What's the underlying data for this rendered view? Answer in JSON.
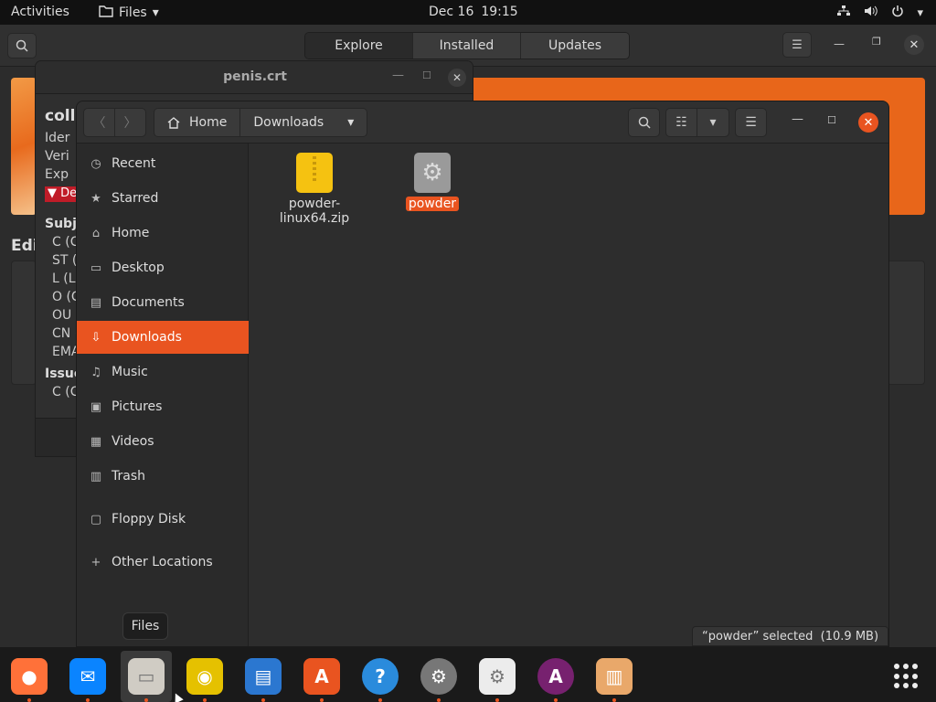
{
  "topbar": {
    "activities": "Activities",
    "app_name": "Files",
    "date": "Dec 16",
    "time": "19:15"
  },
  "software": {
    "tabs": [
      "Explore",
      "Installed",
      "Updates"
    ],
    "editor_label": "Edi"
  },
  "cert_window": {
    "title": "penis.crt",
    "name": "colla",
    "lines": [
      "Ider",
      "Veri",
      "Exp"
    ],
    "expander": "De",
    "subject_heading": "Subje",
    "subject_lines": [
      "C (C",
      "ST (S",
      "L (Lo",
      "O (C",
      "OU (",
      "CN (",
      "EMA"
    ],
    "issuer_heading": "Issue",
    "issuer_lines": [
      "C (C"
    ]
  },
  "files": {
    "path": {
      "home": "Home",
      "current": "Downloads"
    },
    "sidebar": [
      {
        "label": "Recent",
        "icon": "clock-icon",
        "glyph": "◷"
      },
      {
        "label": "Starred",
        "icon": "star-icon",
        "glyph": "★"
      },
      {
        "label": "Home",
        "icon": "home-icon",
        "glyph": "⌂"
      },
      {
        "label": "Desktop",
        "icon": "desktop-icon",
        "glyph": "▭"
      },
      {
        "label": "Documents",
        "icon": "document-icon",
        "glyph": "▤"
      },
      {
        "label": "Downloads",
        "icon": "download-icon",
        "glyph": "⇩"
      },
      {
        "label": "Music",
        "icon": "music-icon",
        "glyph": "♫"
      },
      {
        "label": "Pictures",
        "icon": "pictures-icon",
        "glyph": "▣"
      },
      {
        "label": "Videos",
        "icon": "video-icon",
        "glyph": "▦"
      },
      {
        "label": "Trash",
        "icon": "trash-icon",
        "glyph": "▥"
      },
      {
        "label": "Floppy Disk",
        "icon": "floppy-icon",
        "glyph": "▢"
      },
      {
        "label": "Other Locations",
        "icon": "plus-icon",
        "glyph": "+"
      }
    ],
    "active_item": "Downloads",
    "items": [
      {
        "name_line1": "powder-",
        "name_line2": "linux64.zip",
        "icon": "zip-archive-icon"
      },
      {
        "name": "powder",
        "icon": "executable-icon",
        "selected": true
      }
    ],
    "status": "“powder” selected  (10.9 MB)"
  },
  "tooltip": "Files",
  "dock": [
    {
      "name": "firefox-icon",
      "color": "#ff7139"
    },
    {
      "name": "thunderbird-icon",
      "color": "#0a84ff"
    },
    {
      "name": "files-icon",
      "color": "#d0ccc4",
      "active": true
    },
    {
      "name": "rhythmbox-icon",
      "color": "#e5c100"
    },
    {
      "name": "libreoffice-writer-icon",
      "color": "#2b77d0"
    },
    {
      "name": "software-center-icon",
      "color": "#e95420"
    },
    {
      "name": "help-icon",
      "color": "#2a8bdc"
    },
    {
      "name": "settings-icon",
      "color": "#777777"
    },
    {
      "name": "certificate-viewer-icon",
      "color": "#ececec"
    },
    {
      "name": "software-purple-icon",
      "color": "#77216f"
    },
    {
      "name": "archive-manager-icon",
      "color": "#e9a86a"
    }
  ]
}
